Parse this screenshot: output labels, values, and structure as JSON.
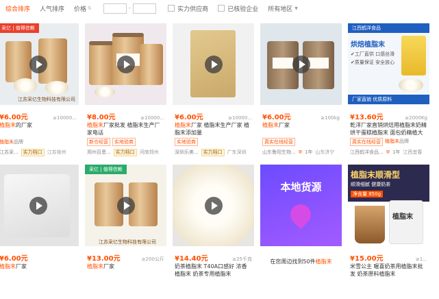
{
  "filters": {
    "sort_overall": "综合排序",
    "sort_popularity": "人气排序",
    "price_label": "价格",
    "price_dash": "-",
    "strong_supplier": "实力供应商",
    "verified_company": "已核验企业",
    "region": "所有地区"
  },
  "products": [
    {
      "img_banner": "采亿 | 值得信赖",
      "img_foot": "江苏采亿生物科技有限公司",
      "price": "¥6.00元",
      "sold": "≥10000...",
      "title_hl": "植脂末",
      "title_rest": "的厂家",
      "tags": [],
      "shop_tag": "植脂末",
      "shop_tag_suffix": "品牌",
      "shop_name": "江苏采...",
      "badge": "实力档口",
      "city": "江苏徐州"
    },
    {
      "price": "¥8.00元",
      "sold": "≥10000...",
      "title_hl": "植脂末",
      "title_rest": "厂家批发 植脂末生产厂家电话",
      "tags": [
        "新仓经营",
        "实地验商"
      ],
      "shop_tag": "植脂末",
      "shop_tag_suffix": "品牌",
      "shop_name": "郑州百恩...",
      "badge": "实力档口",
      "city": "河南郑州"
    },
    {
      "price": "¥6.00元",
      "sold": "≥10000...",
      "title_hl": "植脂末",
      "title_rest": "厂家 植脂末生产厂家 植脂末添加量",
      "tags": [
        "实地验商"
      ],
      "shop_name": "深圳乐美...",
      "badge": "实力档口",
      "city": "广东深圳"
    },
    {
      "price": "¥6.00元",
      "sold": "≥100kg",
      "title_hl": "植脂末",
      "title_rest": "厂家",
      "tags": [
        "真实在线经营"
      ],
      "shop_name": "山东鲁阳生物...",
      "badge": "1年",
      "city": "山东济宁"
    },
    {
      "img_header": "江西鹤洋食品",
      "img_title": "烘焙植脂末",
      "img_points": [
        "✔工厂直供 口感丝滑",
        "✔质量保证 安全放心"
      ],
      "img_foot": "厂家直销 优质原料",
      "price": "¥13.60元",
      "sold": "≥2000Kg",
      "title_hl": "",
      "title_rest": "乾洋厂家直销烘焙用植脂末奶精 烘干蛋糕植脂末 面包奶精植大量批发",
      "tags": [
        "真实在线经营"
      ],
      "shop_tag": "植脂末",
      "shop_tag_suffix": "品牌",
      "shop_name": "江西鹤洋食品...",
      "badge": "1年",
      "city": "江西宜春"
    },
    {
      "price": "¥6.00元",
      "sold": "",
      "title_hl": "植脂末",
      "title_rest": "厂家",
      "tags": [],
      "shop_name": "",
      "badge": "",
      "city": ""
    },
    {
      "img_banner": "采亿 | 值得信赖",
      "img_foot": "江苏采亿生物科技有限公司",
      "price": "¥13.00元",
      "sold": "≥200公斤",
      "title_hl": "植脂末",
      "title_rest": "厂家",
      "tags": [],
      "shop_name": "",
      "badge": "",
      "city": ""
    },
    {
      "price": "¥14.40元",
      "sold": "≥25千克",
      "title_hl": "",
      "title_rest": "奶茶植脂末 T40A口感好 浓香植脂末 奶茶专用植脂末",
      "tags": [],
      "shop_name": "",
      "badge": "",
      "city": ""
    },
    {
      "ad_title": "本地货源",
      "ad_foot_pre": "在您周边找到50件",
      "ad_foot_hl": "植脂末",
      "price": "",
      "sold": "",
      "title_hl": "",
      "title_rest": "",
      "tags": [],
      "shop_name": "",
      "badge": "",
      "city": ""
    },
    {
      "img_title": "植脂末顺滑型",
      "img_sub": "顺滑细腻 健康奶茶",
      "img_price": "净含量 850g",
      "img_pouch": "植脂末",
      "price": "¥15.00元",
      "sold": "≥1...",
      "title_hl": "",
      "title_rest": "米雪公主 喔喜奶茶用植脂末批发 奶茶原料植脂末",
      "tags": [],
      "shop_name": "",
      "badge": "",
      "city": ""
    }
  ]
}
